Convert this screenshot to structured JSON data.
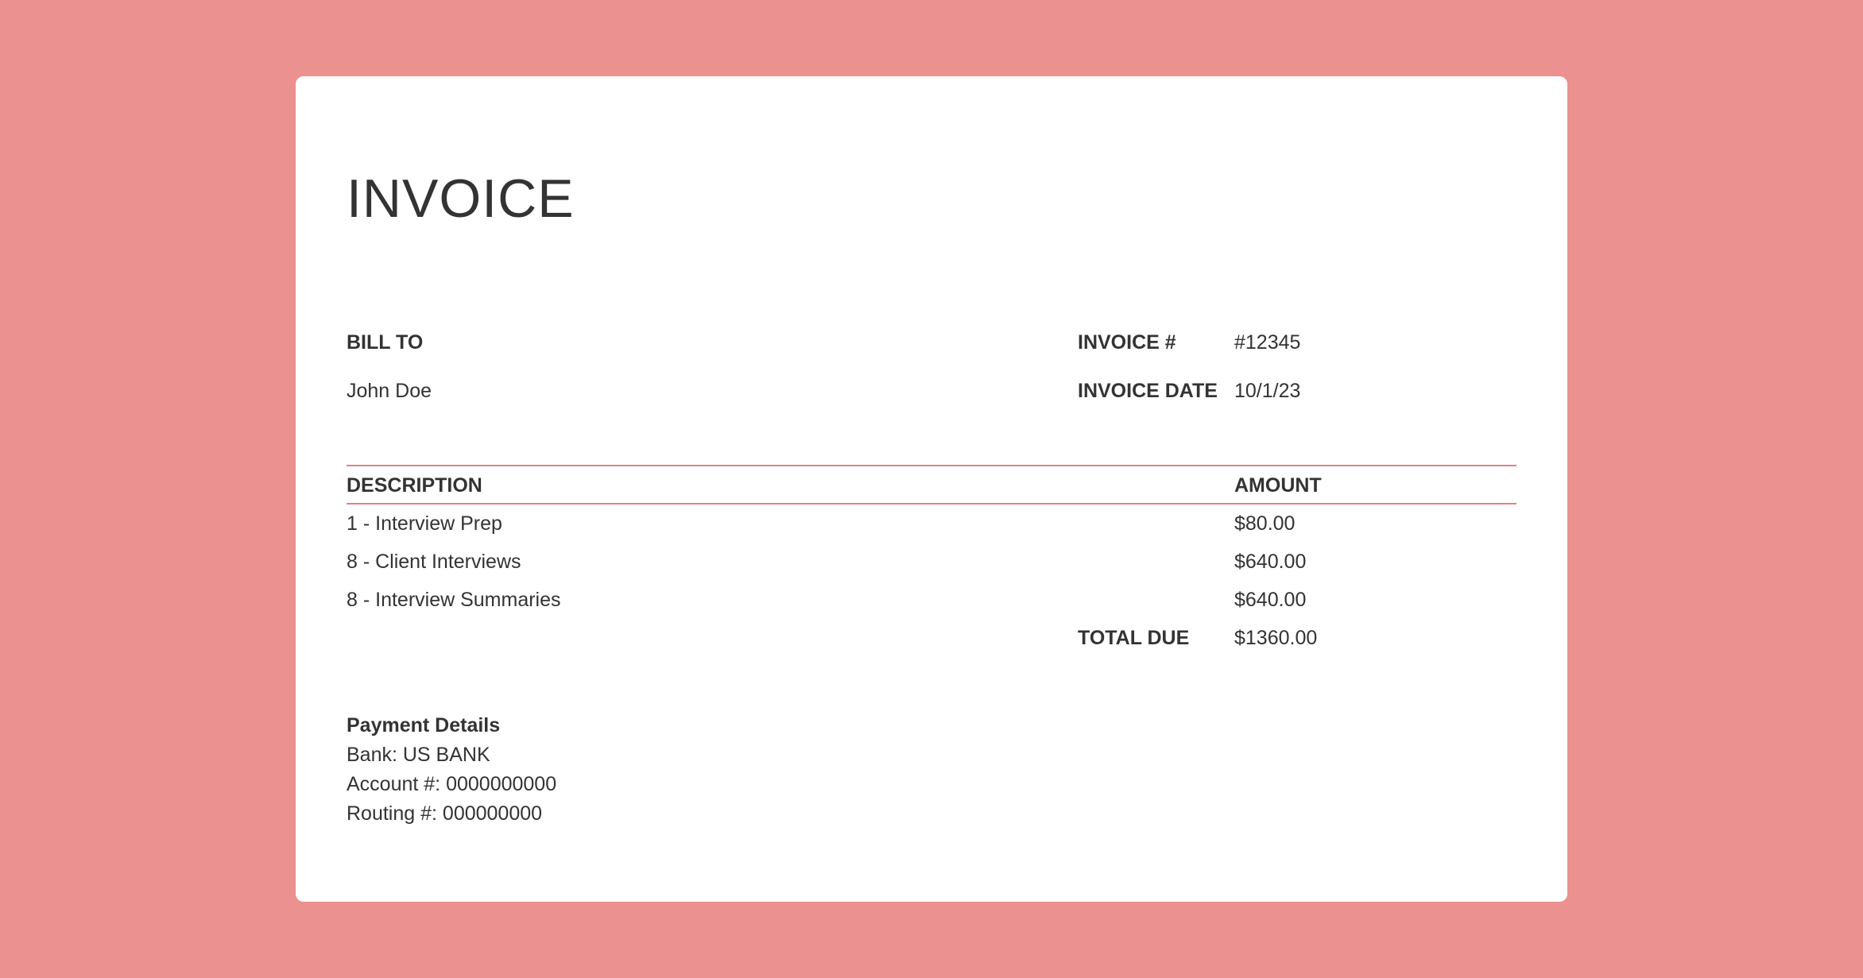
{
  "invoice": {
    "title": "INVOICE",
    "bill_to_label": "BILL TO",
    "bill_to_name": "John Doe",
    "invoice_number_label": "INVOICE #",
    "invoice_number": "#12345",
    "invoice_date_label": "INVOICE DATE",
    "invoice_date": "10/1/23"
  },
  "table": {
    "headers": {
      "description": "DESCRIPTION",
      "amount": "AMOUNT"
    },
    "rows": [
      {
        "description": "1 - Interview Prep",
        "amount": "$80.00"
      },
      {
        "description": "8 - Client Interviews",
        "amount": "$640.00"
      },
      {
        "description": "8 - Interview Summaries",
        "amount": "$640.00"
      }
    ],
    "total_label": "TOTAL DUE",
    "total_value": "$1360.00"
  },
  "payment": {
    "heading": "Payment Details",
    "bank": "Bank: US BANK",
    "account": "Account #: 0000000000",
    "routing": "Routing #: 000000000"
  },
  "colors": {
    "background": "#eb9190",
    "card": "#ffffff",
    "rule": "#e07f86",
    "text": "#333333"
  }
}
